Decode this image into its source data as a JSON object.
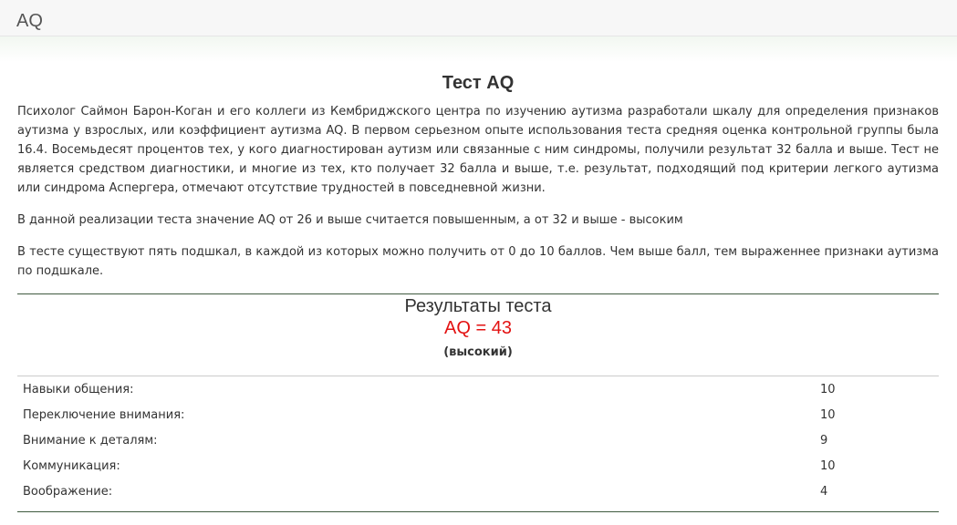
{
  "header": {
    "brand": "AQ"
  },
  "main": {
    "title": "Тест AQ",
    "paragraphs": [
      "Психолог Саймон Барон-Коган и его коллеги из Кембриджского центра по изучению аутизма разработали шкалу для определения признаков аутизма у взрослых, или коэффициент аутизма AQ. В первом серьезном опыте использования теста средняя оценка контрольной группы была 16.4. Восемьдесят процентов тех, у кого диагностирован аутизм или связанные с ним синдромы, получили результат 32 балла и выше. Тест не является средством диагностики, и многие из тех, кто получает 32 балла и выше, т.е. результат, подходящий под критерии легкого аутизма или синдрома Аспергера, отмечают отсутствие трудностей в повседневной жизни.",
      "В данной реализации теста значение AQ от 26 и выше считается повышенным, а от 32 и выше - высоким",
      "В тесте существуют пять подшкал, в каждой из которых можно получить от 0 до 10 баллов. Чем выше балл, тем выраженнее признаки аутизма по подшкале."
    ]
  },
  "results": {
    "title": "Результаты теста",
    "score": "AQ = 43",
    "level": "(высокий)",
    "score_color": "#e31212",
    "subscales": [
      {
        "label": "Навыки общения:",
        "value": "10"
      },
      {
        "label": "Переключение внимания:",
        "value": "10"
      },
      {
        "label": "Внимание к деталям:",
        "value": "9"
      },
      {
        "label": "Коммуникация:",
        "value": "10"
      },
      {
        "label": "Воображение:",
        "value": "4"
      }
    ]
  }
}
